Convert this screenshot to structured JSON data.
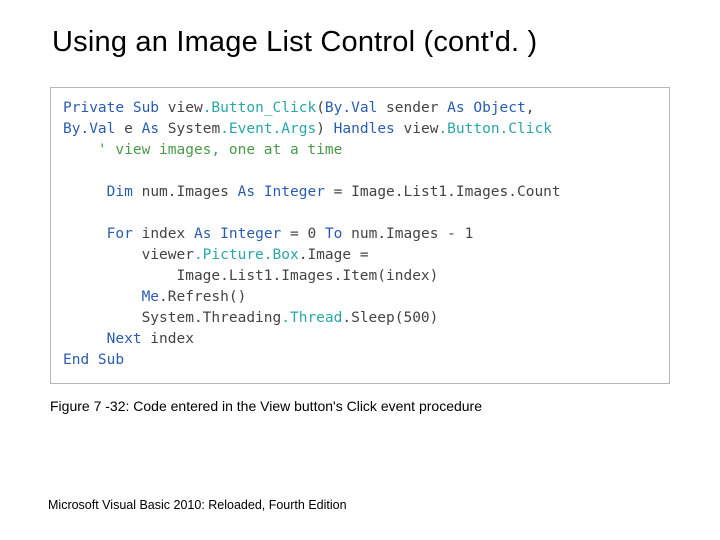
{
  "title": "Using an Image List Control (cont'd. )",
  "caption": "Figure 7 -32: Code entered in the View button's Click event procedure",
  "footer": "Microsoft Visual Basic 2010: Reloaded, Fourth Edition",
  "code": {
    "l1": {
      "a": "Private Sub",
      "b": " view",
      "c": ".Button_Click",
      "d": "(",
      "e": "By.Val",
      "f": " sender ",
      "g": "As",
      "h": " Object",
      "i": ","
    },
    "l2": {
      "a": "By.Val",
      "b": " e ",
      "c": "As",
      "d": " System",
      "e": ".Event.Args",
      "f": ") ",
      "g": "Handles",
      "h": " view",
      "i": ".Button.Click"
    },
    "l3": {
      "a": "    ",
      "b": "' view images, one at a time"
    },
    "l4": {
      "a": "     ",
      "b": "Dim",
      "c": " num.Images ",
      "d": "As",
      "e": " Integer",
      "f": " = Image.List1.Images.Count"
    },
    "l5": {
      "a": "     ",
      "b": "For",
      "c": " index ",
      "d": "As",
      "e": " Integer",
      "f": " = 0 ",
      "g": "To",
      "h": " num.Images - 1"
    },
    "l6": {
      "a": "         viewer",
      "b": ".Picture.Box",
      "c": ".Image ="
    },
    "l7": {
      "a": "             Image.List1.Images.Item(index)"
    },
    "l8": {
      "a": "         ",
      "b": "Me",
      "c": ".Refresh()"
    },
    "l9": {
      "a": "         System.Threading",
      "b": ".Thread",
      "c": ".Sleep(500)"
    },
    "l10": {
      "a": "     ",
      "b": "Next",
      "c": " index"
    },
    "l11": {
      "a": "End Sub"
    }
  }
}
